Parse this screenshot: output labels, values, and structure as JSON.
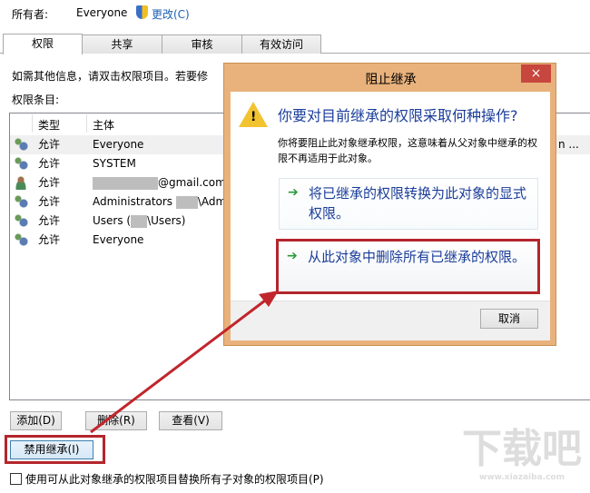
{
  "owner": {
    "label": "所有者:",
    "value": "Everyone",
    "change_link": "更改(C)"
  },
  "tabs": [
    {
      "label": "权限",
      "active": true
    },
    {
      "label": "共享"
    },
    {
      "label": "审核"
    },
    {
      "label": "有效访问"
    }
  ],
  "info_text": "如需其他信息，请双击权限项目。若要修",
  "entries_label": "权限条目:",
  "table": {
    "headers": {
      "type": "类型",
      "principal": "主体"
    },
    "rows": [
      {
        "type": "允许",
        "principal": "Everyone",
        "icon": "group-icon"
      },
      {
        "type": "允许",
        "principal": "SYSTEM",
        "icon": "group-icon"
      },
      {
        "type": "允许",
        "principal": "@gmail.com",
        "icon": "user-icon",
        "redacted_prefix": true
      },
      {
        "type": "允许",
        "principal_prefix": "Administrators ",
        "principal": "\\Admi",
        "icon": "group-icon",
        "redacted_middle": true
      },
      {
        "type": "允许",
        "principal_prefix": "Users (",
        "principal": "\\Users)",
        "icon": "group-icon",
        "redacted_middle": true
      },
      {
        "type": "允许",
        "principal": "Everyone",
        "icon": "group-icon"
      }
    ],
    "truncated_cell": "n ..."
  },
  "buttons": {
    "add": "添加(D)",
    "remove": "删除(R)",
    "view": "查看(V)",
    "disable_inheritance": "禁用继承(I)"
  },
  "checkbox": {
    "label": "使用可从此对象继承的权限项目替换所有子对象的权限项目(P)",
    "checked": false
  },
  "dialog": {
    "title": "阻止继承",
    "heading": "你要对目前继承的权限采取何种操作?",
    "description": "你将要阻止此对象继承权限，这意味着从父对象中继承的权限不再适用于此对象。",
    "option1": "将已继承的权限转换为此对象的显式权限。",
    "option2": "从此对象中删除所有已继承的权限。",
    "cancel": "取消",
    "close": "×"
  },
  "watermark": "下载吧 www.xiazaiba.com",
  "colors": {
    "highlight": "#c0262c",
    "link": "#1a3d9a",
    "dialog_frame": "#e9b27c",
    "close": "#c7463d"
  }
}
